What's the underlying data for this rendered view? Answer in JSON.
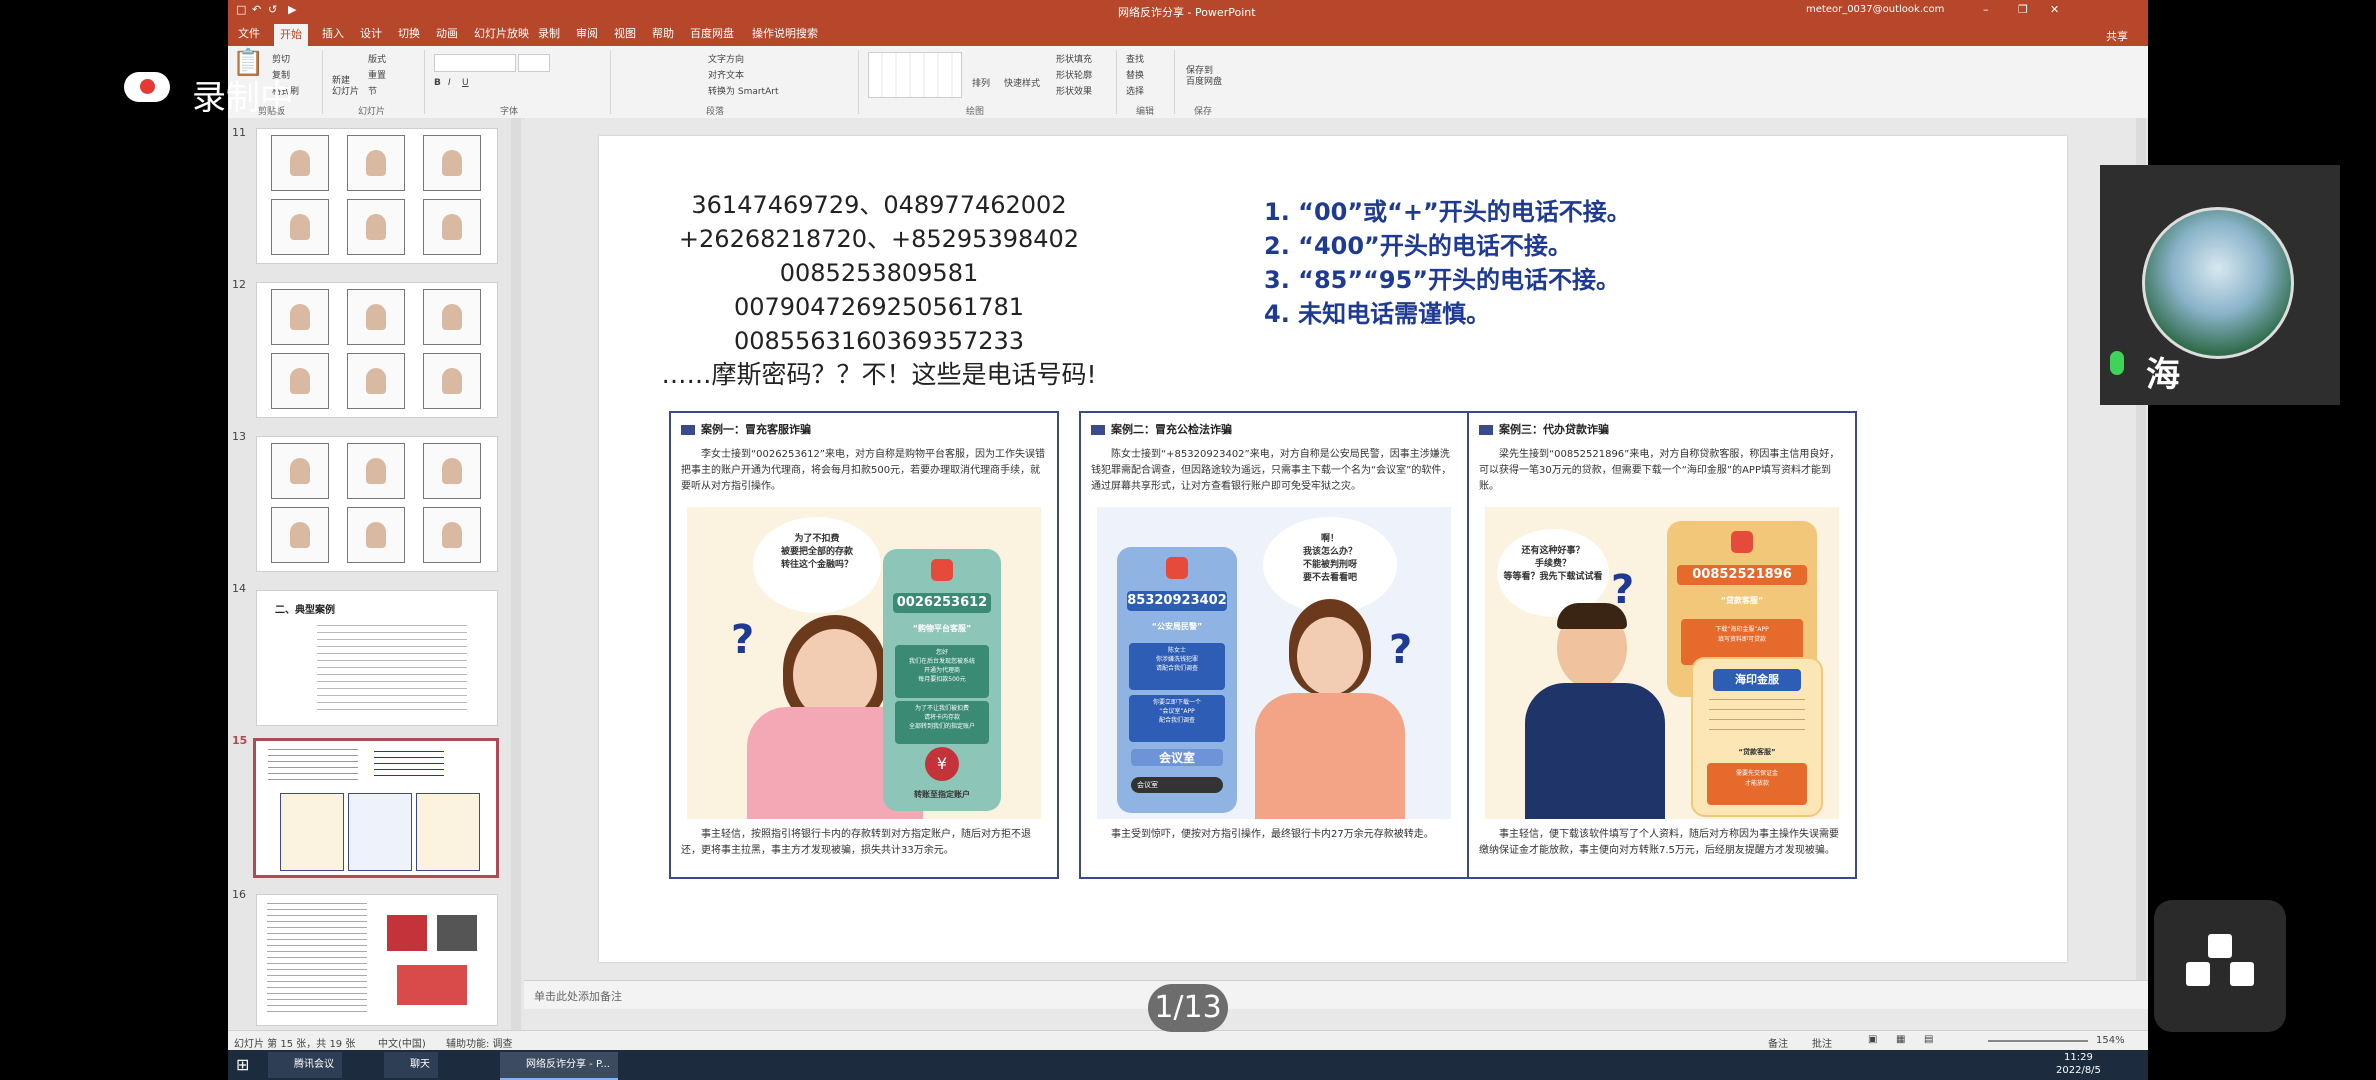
{
  "window": {
    "title": "网络反诈分享 - PowerPoint",
    "account": "meteor_0037@outlook.com",
    "share_label": "共享"
  },
  "tabs": [
    "文件",
    "开始",
    "插入",
    "设计",
    "切换",
    "动画",
    "幻灯片放映",
    "录制",
    "审阅",
    "视图",
    "帮助",
    "百度网盘",
    "操作说明搜索"
  ],
  "active_tab": "开始",
  "ribbon_groups": [
    "剪贴板",
    "幻灯片",
    "字体",
    "段落",
    "绘图",
    "编辑",
    "保存"
  ],
  "ribbon_buttons": {
    "cut": "剪切",
    "copy": "复制",
    "format_painter": "格式刷",
    "new_slide": "新建\n幻灯片",
    "layout": "版式",
    "reset": "重置",
    "section": "节",
    "find": "查找",
    "replace": "替换",
    "select": "选择",
    "save_baidu": "保存到\n百度网盘",
    "arrange": "排列",
    "quick_styles": "快速样式",
    "text_direction": "文字方向",
    "align_text": "对齐文本",
    "smartart": "转换为 SmartArt",
    "shape_fill": "形状填充",
    "shape_outline": "形状轮廓",
    "shape_effects": "形状效果"
  },
  "thumbnails": [
    {
      "num": "11",
      "selected": false
    },
    {
      "num": "12",
      "selected": false
    },
    {
      "num": "13",
      "selected": false
    },
    {
      "num": "14",
      "selected": false,
      "heading": "二、典型案例"
    },
    {
      "num": "15",
      "selected": true
    },
    {
      "num": "16",
      "selected": false
    }
  ],
  "slide": {
    "numbers": [
      "36147469729、048977462002",
      "+26268218720、+85295398402",
      "0085253809581",
      "0079047269250561781",
      "0085563160369357233",
      "……摩斯密码？？不！这些是电话号码!"
    ],
    "tips": [
      "1. “00”或“+”开头的电话不接。",
      "2. “400”开头的电话不接。",
      "3. “85”“95”开头的电话不接。",
      "4. 未知电话需谨慎。"
    ],
    "cases": [
      {
        "title": "案例一：冒充客服诈骗",
        "body": "李女士接到“0026253612”来电，对方自称是购物平台客服，因为工作失误错把事主的账户开通为代理商，将会每月扣款500元，若要办理取消代理商手续，就要听从对方指引操作。",
        "bubble": "为了不扣费\n被要把全部的存款\n转往这个金融吗？",
        "phone_number": "0026253612",
        "phone_lines": [
          "“购物平台客服”",
          "您好\n我们在后台发现您被系统\n开通为代理商\n每月要扣款500元",
          "为了不让我们被扣费\n请将卡内存款\n全部转到我们的指定账户"
        ],
        "phone_footer": "转账至指定账户",
        "foot": "事主轻信，按照指引将银行卡内的存款转到对方指定账户，随后对方拒不退还，更将事主拉黑，事主方才发现被骗，损失共计33万余元。"
      },
      {
        "title": "案例二：冒充公检法诈骗",
        "body": "陈女士接到“+85320923402”来电，对方自称是公安局民警，因事主涉嫌洗钱犯罪需配合调查，但因路途较为遥远，只需事主下载一个名为“会议室”的软件，通过屏幕共享形式，让对方查看银行账户即可免受牢狱之灾。",
        "bubble": "啊！\n我该怎么办？\n不能被判刑呀\n要不去看看吧",
        "phone_number": "85320923402",
        "phone_lines": [
          "“公安局民警”",
          "陈女士\n你涉嫌洗钱犯罪\n请配合我们调查",
          "你要立即下载一个\n“会议室”APP\n配合我们调查"
        ],
        "phone_footer": "会议室",
        "app_bar": "会议室",
        "foot": "事主受到惊吓，便按对方指引操作，最终银行卡内27万余元存款被转走。"
      },
      {
        "title": "案例三：代办贷款诈骗",
        "body": "梁先生接到“00852521896”来电，对方自称贷款客服，称因事主信用良好，可以获得一笔30万元的贷款，但需要下载一个“海印金服”的APP填写资料才能到账。",
        "bubble": "还有这种好事？\n手续费？\n等等看？我先下载试试看",
        "phone_number": "00852521896",
        "phone_lines": [
          "“贷款客服”",
          "下载“海印金服”APP\n填写资料即可贷款"
        ],
        "app_name": "海印金服",
        "app_lines": [
          "“贷款客服”",
          "需要先交保证金\n才能放款"
        ],
        "foot": "事主轻信，便下载该软件填写了个人资料，随后对方称因为事主操作失误需要缴纳保证金才能放款，事主便向对方转账7.5万元，后经朋友提醒方才发现被骗。"
      }
    ]
  },
  "notes_placeholder": "单击此处添加备注",
  "status": {
    "slide_info": "幻灯片 第 15 张，共 19 张",
    "language": "中文(中国)",
    "accessibility": "辅助功能: 调查",
    "notes": "备注",
    "comments": "批注",
    "zoom": "154%"
  },
  "taskbar": {
    "items": [
      "腾讯会议",
      "聊天",
      "网络反诈分享 - P..."
    ],
    "time": "11:29",
    "date": "2022/8/5"
  },
  "overlay": {
    "recording_label": "录制中",
    "participant_name": "海",
    "pager": "1/13"
  },
  "colors": {
    "ppt_accent": "#b7472a",
    "tip_blue": "#1f3a93",
    "card_border": "#3b4a8a"
  }
}
